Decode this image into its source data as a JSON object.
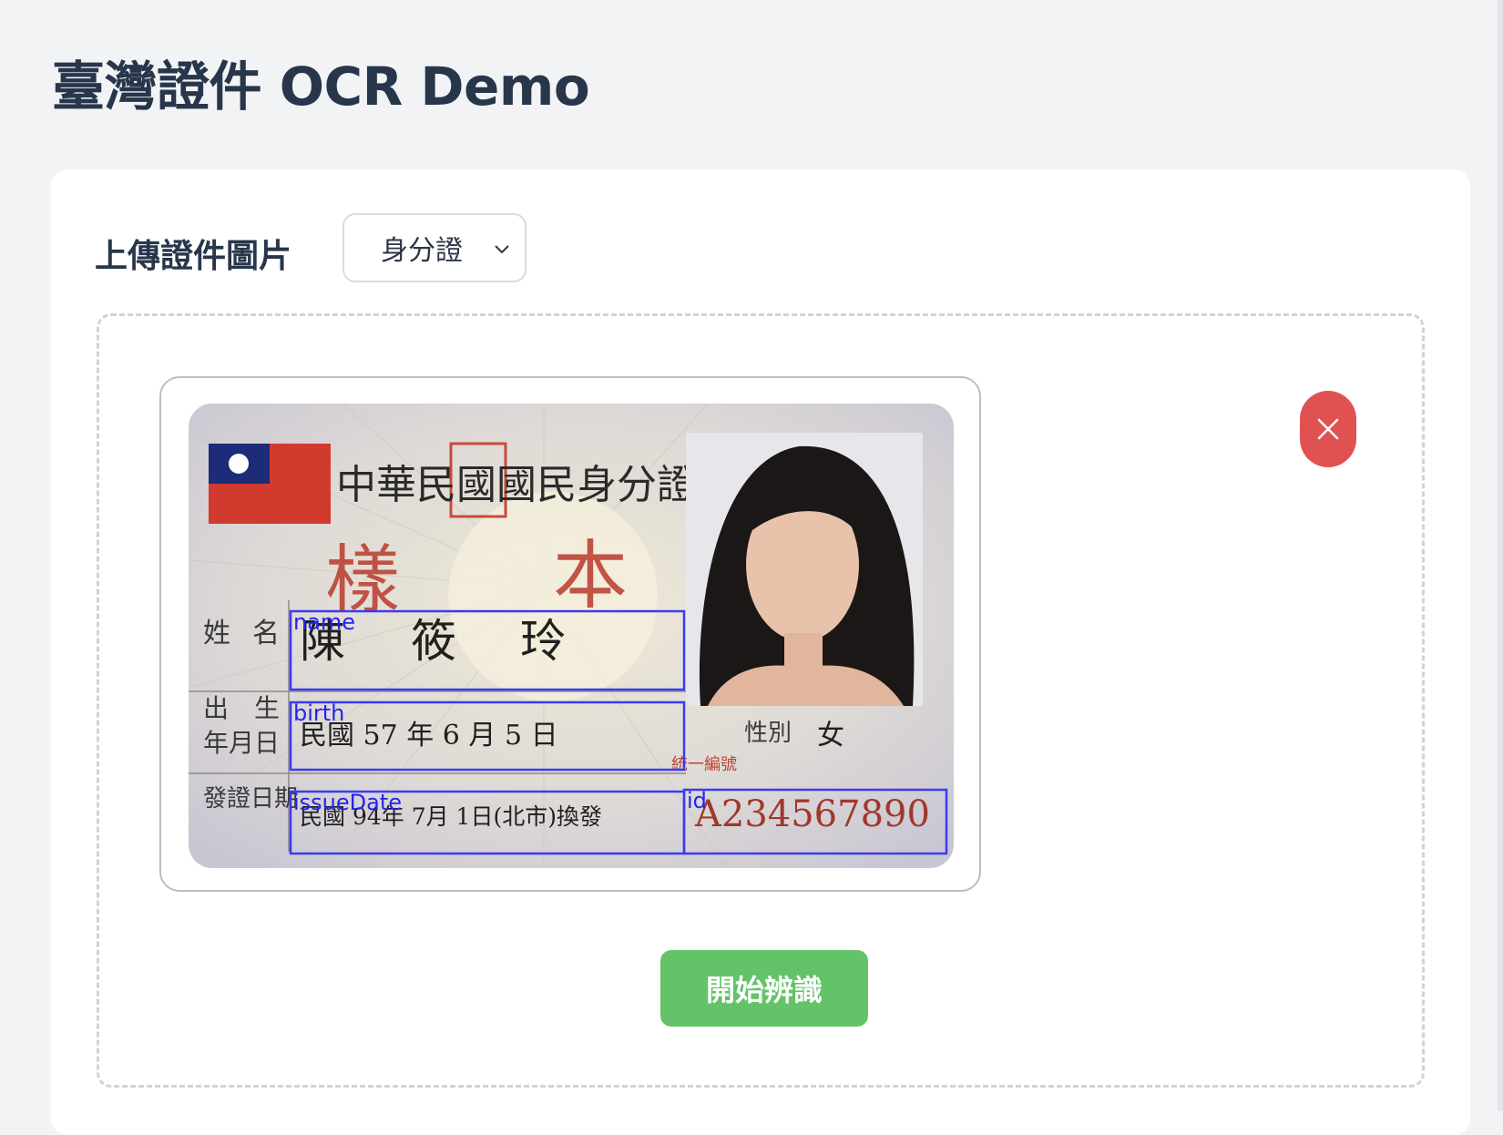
{
  "page": {
    "title": "臺灣證件 OCR Demo"
  },
  "upload": {
    "label": "上傳證件圖片",
    "doc_type_selected": "身分證"
  },
  "id_card": {
    "heading": "中華民國國民身分證",
    "watermark_left": "樣",
    "watermark_right": "本",
    "field_labels": {
      "name_l1": "姓",
      "name_l2": "名",
      "birth_l1": "出　生",
      "birth_l2": "年月日",
      "issue": "發證日期",
      "gender": "性別",
      "id_caption": "統一編號"
    },
    "name_chars": [
      "陳",
      "筱",
      "玲"
    ],
    "birth_value": "民國 57 年 6 月 5 日",
    "gender_value": "女",
    "issue_value": "民國 94年 7月 1日(北市)換發",
    "id_number": "A234567890",
    "ocr_boxes": [
      {
        "tag": "name"
      },
      {
        "tag": "birth"
      },
      {
        "tag": "issueDate"
      },
      {
        "tag": "id"
      }
    ],
    "box_color": "#3a3af5"
  },
  "actions": {
    "remove_icon": "close-icon",
    "start_label": "開始辨識",
    "start_color": "#63c368",
    "remove_color": "#e05252"
  }
}
